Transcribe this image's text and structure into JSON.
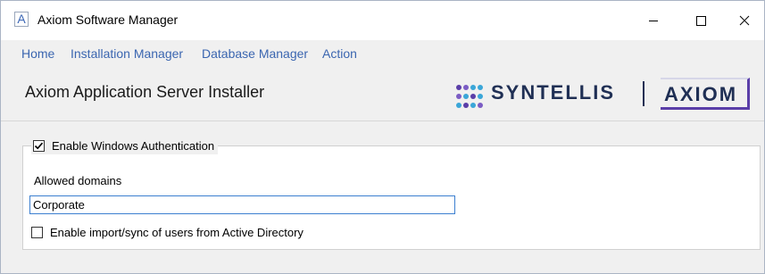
{
  "window": {
    "app_icon_letter": "A",
    "title": "Axiom Software Manager",
    "minimize_icon": "minimize-icon",
    "maximize_icon": "maximize-icon",
    "close_icon": "close-icon"
  },
  "menu": {
    "items": [
      {
        "label": "Home"
      },
      {
        "label": "Installation Manager"
      },
      {
        "label": "Database Manager"
      },
      {
        "label": "Action"
      }
    ]
  },
  "header": {
    "title": "Axiom Application Server Installer",
    "logo": {
      "brand": "SYNTELLIS",
      "product": "AXIOM",
      "brand_color": "#1f2f54",
      "accent_color": "#5a3ea8"
    }
  },
  "auth": {
    "enable_windows_auth": {
      "label": "Enable Windows Authentication",
      "checked": true
    },
    "allowed_domains_label": "Allowed domains",
    "allowed_domains_value": "Corporate",
    "import_sync": {
      "label": "Enable import/sync of users from Active Directory",
      "checked": false
    }
  },
  "colors": {
    "menu_link": "#3b66b0",
    "focus_border": "#3c7fd0",
    "background": "#f0f0f0"
  }
}
